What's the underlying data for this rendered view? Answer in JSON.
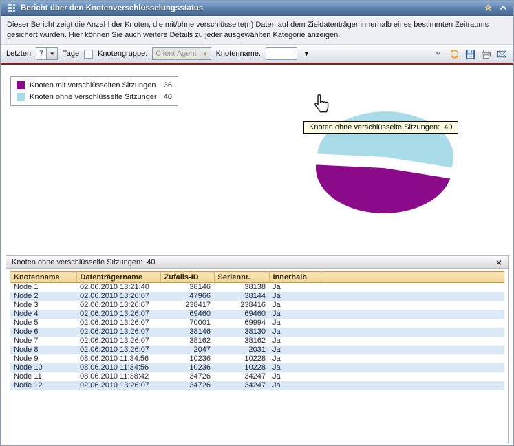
{
  "window": {
    "title": "Bericht über den Knotenverschlüsselungsstatus",
    "description": "Dieser Bericht zeigt die Anzahl der Knoten, die mit/ohne verschlüsselte(n) Daten auf dem Zieldatenträger innerhalb eines bestimmten Zeitraums gesichert wurden. Hier können Sie auch weitere Details zu jeder ausgewählten Kategorie anzeigen."
  },
  "toolbar": {
    "letzten_label": "Letzten",
    "days_value": "7",
    "tage_label": "Tage",
    "knotengruppe_label": "Knotengruppe:",
    "knotengruppe_value": "Client Agent",
    "knotenname_label": "Knotenname:",
    "knotenname_value": ""
  },
  "legend": {
    "items": [
      {
        "label": "Knoten mit verschlüsselten Sitzungen",
        "value": "36",
        "color": "#8a0a8a"
      },
      {
        "label": "Knoten ohne verschlüsselte Sitzunger",
        "value": "40",
        "color": "#a9dbe8"
      }
    ]
  },
  "tooltip_text": "Knoten ohne verschlüsselte Sitzungen:  40",
  "detail_panel": {
    "title": "Knoten ohne verschlüsselte Sitzungen:  40",
    "close_label": "×",
    "table": {
      "headers": [
        "Knotenname",
        "Datenträgername",
        "Zufalls-ID",
        "Seriennr.",
        "Innerhalb"
      ],
      "rows": [
        [
          "Node 1",
          "02.06.2010 13:21:40",
          "38146",
          "38138",
          "Ja"
        ],
        [
          "Node 2",
          "02.06.2010 13:26:07",
          "47966",
          "38144",
          "Ja"
        ],
        [
          "Node 3",
          "02.06.2010 13:26:07",
          "238417",
          "238416",
          "Ja"
        ],
        [
          "Node 4",
          "02.06.2010 13:26:07",
          "69460",
          "69460",
          "Ja"
        ],
        [
          "Node 5",
          "02.06.2010 13:26:07",
          "70001",
          "69994",
          "Ja"
        ],
        [
          "Node 6",
          "02.06.2010 13:26:07",
          "38146",
          "38130",
          "Ja"
        ],
        [
          "Node 7",
          "02.06.2010 13:26:07",
          "38162",
          "38162",
          "Ja"
        ],
        [
          "Node 8",
          "02.06.2010 13:26:07",
          "2047",
          "2031",
          "Ja"
        ],
        [
          "Node 9",
          "08.06.2010 11:34:56",
          "10236",
          "10228",
          "Ja"
        ],
        [
          "Node 10",
          "08.06.2010 11:34:56",
          "10236",
          "10228",
          "Ja"
        ],
        [
          "Node 11",
          "08.06.2010 11:38:42",
          "34726",
          "34247",
          "Ja"
        ],
        [
          "Node 12",
          "02.06.2010 13:26:07",
          "34726",
          "34247",
          "Ja"
        ]
      ]
    }
  },
  "chart_data": {
    "type": "pie",
    "labels": [
      "Knoten mit verschlüsselten Sitzungen",
      "Knoten ohne verschlüsselte Sitzungen"
    ],
    "values": [
      36,
      40
    ],
    "colors": [
      "#8a0a8a",
      "#a9dbe8"
    ],
    "exploded_slice": "Knoten ohne verschlüsselte Sitzungen",
    "legend_position": "top-left"
  }
}
